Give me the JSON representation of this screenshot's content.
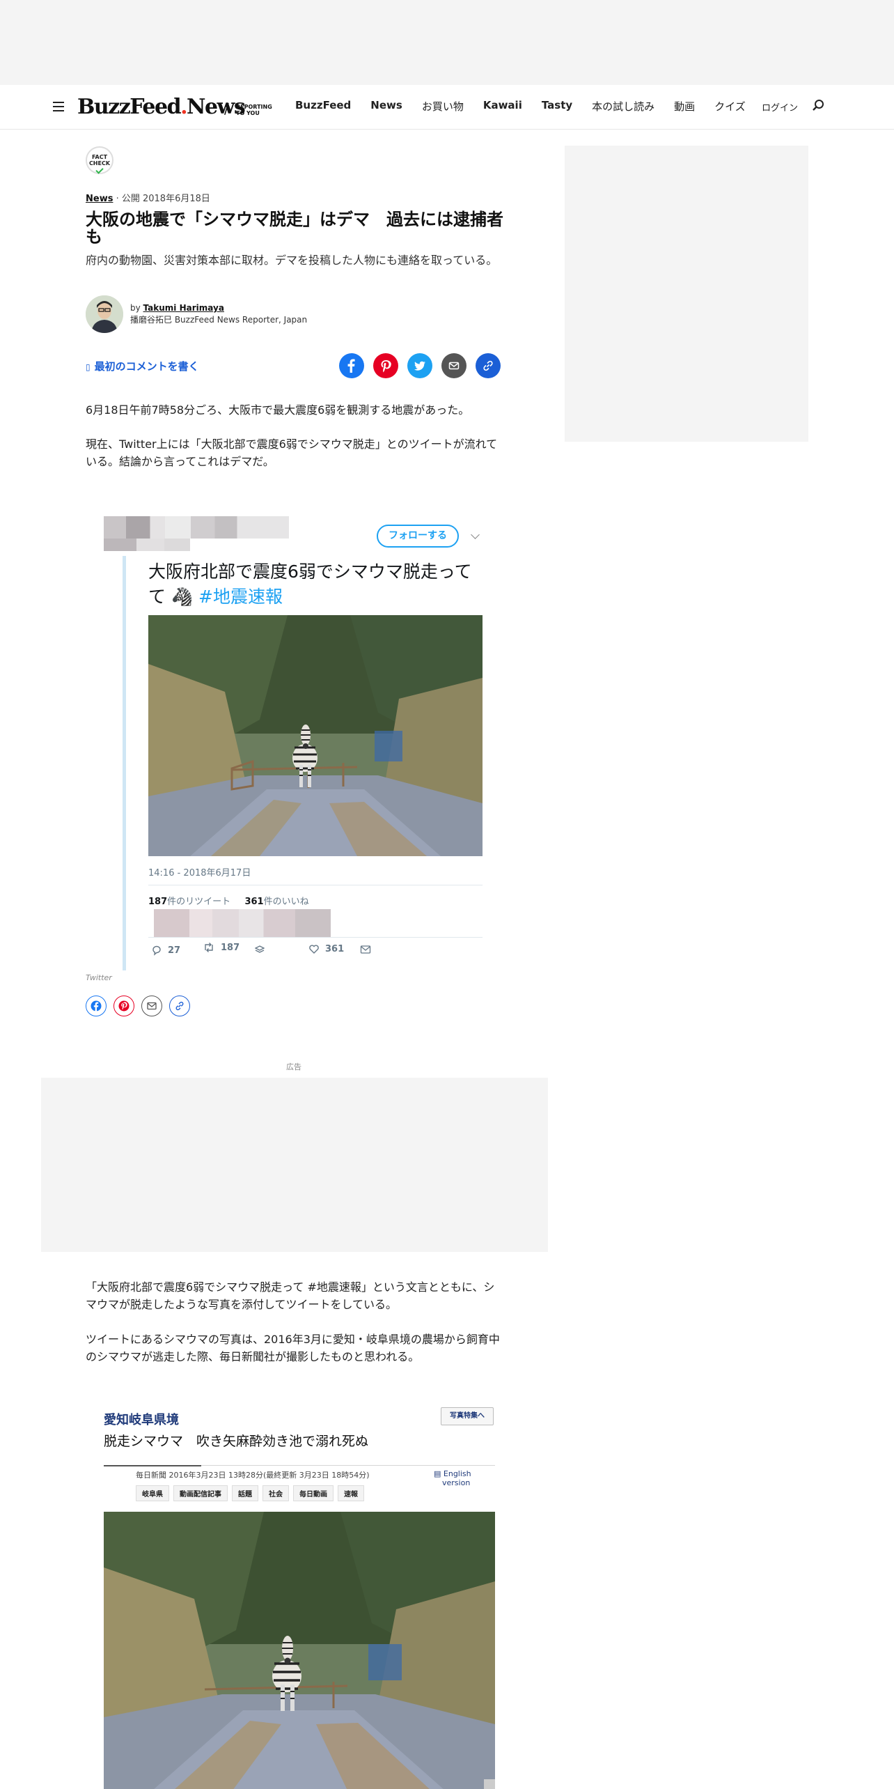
{
  "nav": {
    "brand": "BuzzFeed",
    "brand_suffix": "News",
    "tagline_line1": "REPORTING",
    "tagline_line2": "TO YOU",
    "links": [
      "BuzzFeed",
      "News",
      "お買い物",
      "Kawaii",
      "Tasty",
      "本の試し読み",
      "動画",
      "クイズ"
    ],
    "login": "ログイン"
  },
  "article": {
    "fact_check_line1": "FACT",
    "fact_check_line2": "CHECK",
    "category": "News",
    "published": "公開 2018年6月18日",
    "headline": "大阪の地震で「シマウマ脱走」はデマ　過去には逮捕者も",
    "subhead": "府内の動物園、災害対策本部に取材。デマを投稿した人物にも連絡を取っている。",
    "byline_prefix": "by",
    "author": "Takumi Harimaya",
    "author_title": "播磨谷拓巳 BuzzFeed News Reporter, Japan",
    "comment_link": "最初のコメントを書く",
    "para1": "6月18日午前7時58分ごろ、大阪市で最大震度6弱を観測する地震があった。",
    "para2": "現在、Twitter上には「大阪北部で震度6弱でシマウマ脱走」とのツイートが流れている。結論から言ってこれはデマだ。",
    "para3": "「大阪府北部で震度6弱でシマウマ脱走って #地震速報」という文言とともに、シマウマが脱走したような写真を添付してツイートをしている。",
    "para4": "ツイートにあるシマウマの写真は、2016年3月に愛知・岐阜県境の農場から飼育中のシマウマが逃走した際、毎日新聞社が撮影したものと思われる。"
  },
  "tweet": {
    "follow": "フォローする",
    "text": "大阪府北部で震度6弱でシマウマ脱走って",
    "hashtag": "#地震速報",
    "timestamp": "14:16 - 2018年6月17日",
    "retweets_count": "187",
    "retweets_label": "件のリツイート",
    "likes_count": "361",
    "likes_label": "件のいいね",
    "reply_count": "27",
    "retweet_count": "187",
    "like_count": "361",
    "credit": "Twitter"
  },
  "ad_label": "広告",
  "mainichi": {
    "region": "愛知岐阜県境",
    "photo_button": "写真特集へ",
    "title": "脱走シマウマ　吹き矢麻酔効き池で溺れ死ぬ",
    "date": "毎日新聞 2016年3月23日 13時28分(最終更新 3月23日 18時54分)",
    "english_line1": "English",
    "english_line2": "version",
    "tags": [
      "岐阜県",
      "動画配信記事",
      "話題",
      "社会",
      "毎日動画",
      "速報"
    ]
  },
  "colors": {
    "facebook": "#1877f2",
    "pinterest": "#e60023",
    "twitter": "#1da1f2",
    "email": "#555555",
    "link": "#1b5fd6"
  }
}
